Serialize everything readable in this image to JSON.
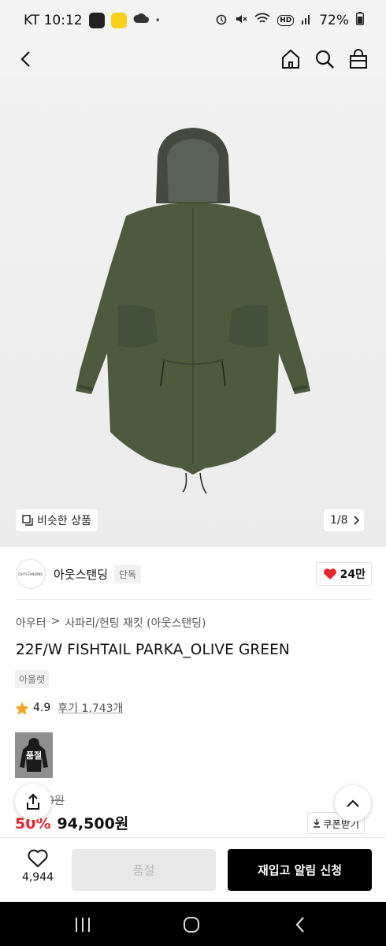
{
  "status_bar": {
    "carrier_time": "KT 10:12",
    "battery": "72%",
    "dot": "•",
    "left_icons": [
      "news-app-icon",
      "chat-app-icon",
      "weather-app-icon"
    ],
    "right_icons": [
      "alarm-icon",
      "mute-icon",
      "wifi-icon",
      "hd-icon",
      "signal-icon",
      "battery-icon"
    ],
    "hd_label": "HD"
  },
  "nav": {
    "icons": [
      "back-arrow-icon",
      "home-icon",
      "search-icon",
      "shopping-bag-icon"
    ]
  },
  "gallery": {
    "similar_label": "비슷한 상품",
    "counter": "1/8",
    "counter_icon": "chevron-right-icon"
  },
  "brand": {
    "name": "아웃스탠딩",
    "logo_text": "OUTSTANDING",
    "exclusive_tag": "단독",
    "likes": "24만",
    "colors": {
      "heart": "#e6272e"
    }
  },
  "breadcrumb": {
    "category": "아우터",
    "separator": ">",
    "subcategory": "사파리/헌팅 재킷 (아웃스탠딩)"
  },
  "product": {
    "title": "22F/W FISHTAIL PARKA_OLIVE GREEN",
    "outlet_tag": "아울렛",
    "rating": "4.9",
    "review_label": "후기 1,743개",
    "thumbnail_label": "품절",
    "original_price_partial": "0원",
    "discount_partial": "50%",
    "price": "94,500원",
    "coupon_label": "쿠폰받기",
    "colors": {
      "discount": "#e6272e",
      "star": "#f5a623"
    }
  },
  "bottom_bar": {
    "wish_count": "4,944",
    "soldout_label": "품절",
    "restock_label": "재입고 알림 신청"
  },
  "system_nav": {
    "icons": [
      "recent-apps-icon",
      "home-circle-icon",
      "system-back-icon"
    ]
  }
}
